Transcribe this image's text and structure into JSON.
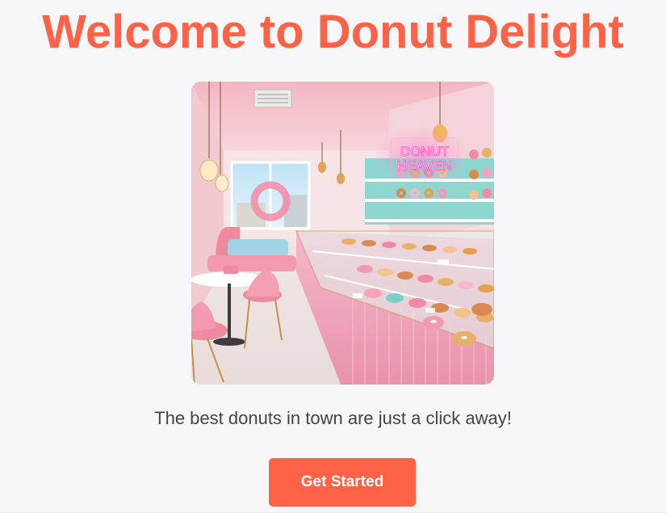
{
  "page": {
    "title": "Welcome to Donut Delight",
    "tagline": "The best donuts in town are just a click away!",
    "cta_label": "Get Started",
    "accent_color": "#ff6347"
  },
  "hero_image": {
    "sign_text_line1": "DONUT",
    "sign_text_line2": "HEAVEN"
  }
}
